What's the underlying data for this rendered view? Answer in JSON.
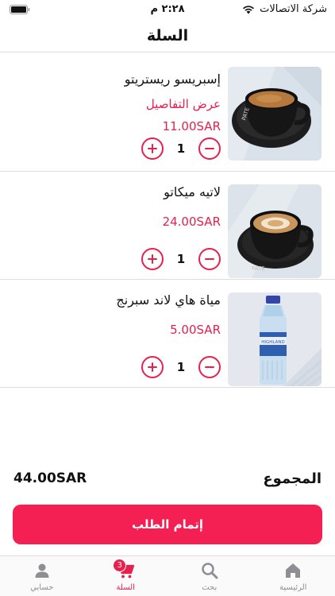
{
  "status_bar": {
    "carrier": "شركة الاتصالات",
    "time": "٢:٢٨ م"
  },
  "header": {
    "title": "السلة"
  },
  "cart": {
    "items": [
      {
        "name": "إسبريسو ريستريتو",
        "details_label": "عرض التفاصيل",
        "price": "11.00SAR",
        "quantity": "1",
        "image": "espresso-cup-image"
      },
      {
        "name": "لاتيه ميكاتو",
        "details_label": "",
        "price": "24.00SAR",
        "quantity": "1",
        "image": "latte-cup-image"
      },
      {
        "name": "مياة هاي لاند سبرنج",
        "details_label": "",
        "price": "5.00SAR",
        "quantity": "1",
        "image": "water-bottle-image"
      }
    ]
  },
  "summary": {
    "total_label": "المجموع",
    "total_amount": "44.00SAR"
  },
  "checkout": {
    "label": "إتمام الطلب"
  },
  "tab_bar": {
    "tabs": [
      {
        "label": "الرئيسية",
        "icon": "home-icon"
      },
      {
        "label": "بحث",
        "icon": "search-icon"
      },
      {
        "label": "السلة",
        "icon": "cart-icon",
        "badge": "3"
      },
      {
        "label": "حسابي",
        "icon": "person-icon"
      }
    ]
  },
  "colors": {
    "accent": "#e8204d",
    "button": "#f41f52",
    "inactive": "#8e8e93"
  }
}
